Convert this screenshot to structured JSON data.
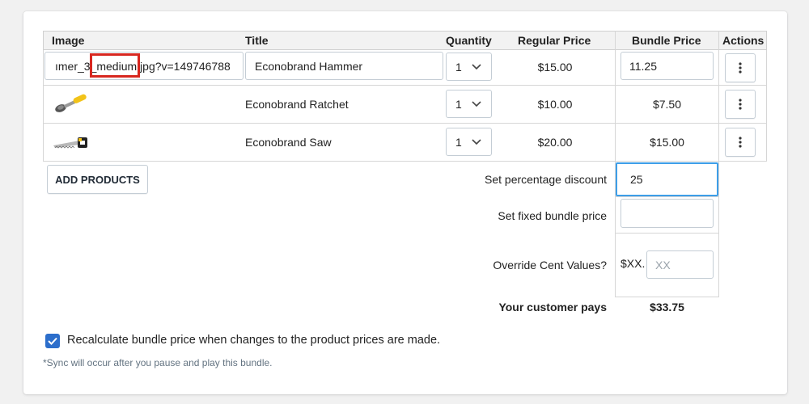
{
  "table": {
    "headers": {
      "image": "Image",
      "title": "Title",
      "quantity": "Quantity",
      "regular_price": "Regular Price",
      "bundle_price": "Bundle Price",
      "actions": "Actions"
    },
    "rows": [
      {
        "image_url_value": "ımer_3_medium.jpg?v=149746788",
        "title": "Econobrand Hammer",
        "quantity": "1",
        "regular_price": "$15.00",
        "bundle_price": "11.25"
      },
      {
        "image_icon": "ratchet-image",
        "title": "Econobrand Ratchet",
        "quantity": "1",
        "regular_price": "$10.00",
        "bundle_price": "$7.50"
      },
      {
        "image_icon": "saw-image",
        "title": "Econobrand Saw",
        "quantity": "1",
        "regular_price": "$20.00",
        "bundle_price": "$15.00"
      }
    ]
  },
  "add_products_label": "ADD PRODUCTS",
  "settings": {
    "percentage_label": "Set percentage discount",
    "percentage_value": "25",
    "fixed_label": "Set fixed bundle price",
    "fixed_value": "",
    "override_label": "Override Cent Values?",
    "override_prefix": "$XX.",
    "override_placeholder": "XX",
    "customer_pays_label": "Your customer pays",
    "customer_pays_value": "$33.75"
  },
  "recalculate_label": "Recalculate bundle price when changes to the product prices are made.",
  "recalculate_checked": true,
  "sync_note": "*Sync will occur after you pause and play this bundle.",
  "colors": {
    "accent": "#2c6ecb",
    "focus_border": "#3d9ee8",
    "highlight": "#d8271f"
  }
}
